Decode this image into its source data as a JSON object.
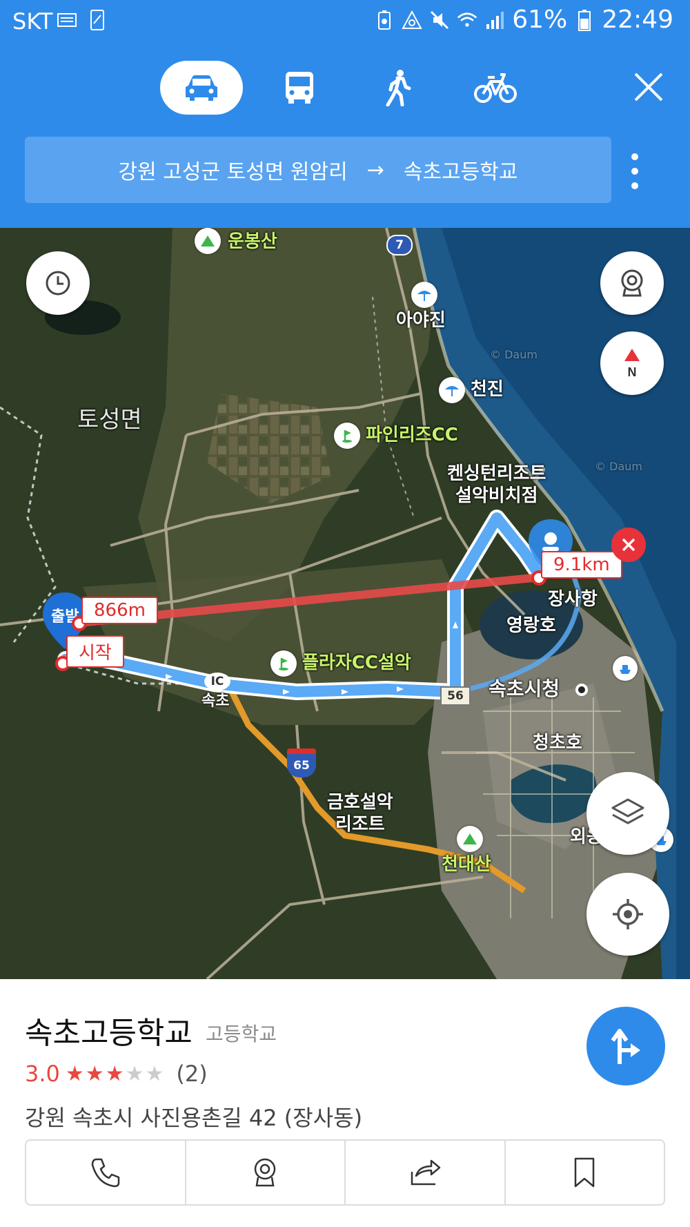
{
  "status_bar": {
    "carrier": "SKT",
    "battery": "61%",
    "time": "22:49"
  },
  "header": {
    "modes": [
      "car",
      "bus",
      "walk",
      "bicycle"
    ],
    "active_mode": "car",
    "route_from": "강원 고성군 토성면 원암리",
    "route_arrow": "→",
    "route_to": "속초고등학교"
  },
  "map": {
    "places": {
      "unbongsan": "운봉산",
      "ayajin": "아야진",
      "cheonjin": "천진",
      "tosungmyeon": "토성면",
      "pinerizcc": "파인리즈CC",
      "kensington": "켄싱턴리조트\n설악비치점",
      "jangsahang": "장사항",
      "yeongrangho": "영랑호",
      "plazacc": "플라자CC설악",
      "sokchosicheong": "속초시청",
      "cheongchoho": "청초호",
      "kumho": "금호설악\n리조트",
      "sokcho": "속초",
      "oeongchi": "외옹치항",
      "cheondaesan": "천대산",
      "start_partial": "출발"
    },
    "road_numbers": {
      "r7": "7",
      "r56": "56",
      "r65": "65",
      "ic": "IC"
    },
    "distance_labels": {
      "start": "시작",
      "segment": "866m",
      "total": "9.1km"
    },
    "watermarks": [
      "© Daum",
      "© Daum"
    ]
  },
  "place_card": {
    "name": "속초고등학교",
    "category": "고등학교",
    "rating_value": "3.0",
    "rating_stars": 3,
    "rating_max": 5,
    "review_count": "(2)",
    "address": "강원 속초시 사진용촌길 42 (장사동)"
  },
  "colors": {
    "header_blue": "#2f8bea",
    "route_blue": "#5aaaf5",
    "measure_red": "#e02c2c",
    "star_red": "#e8483f"
  }
}
